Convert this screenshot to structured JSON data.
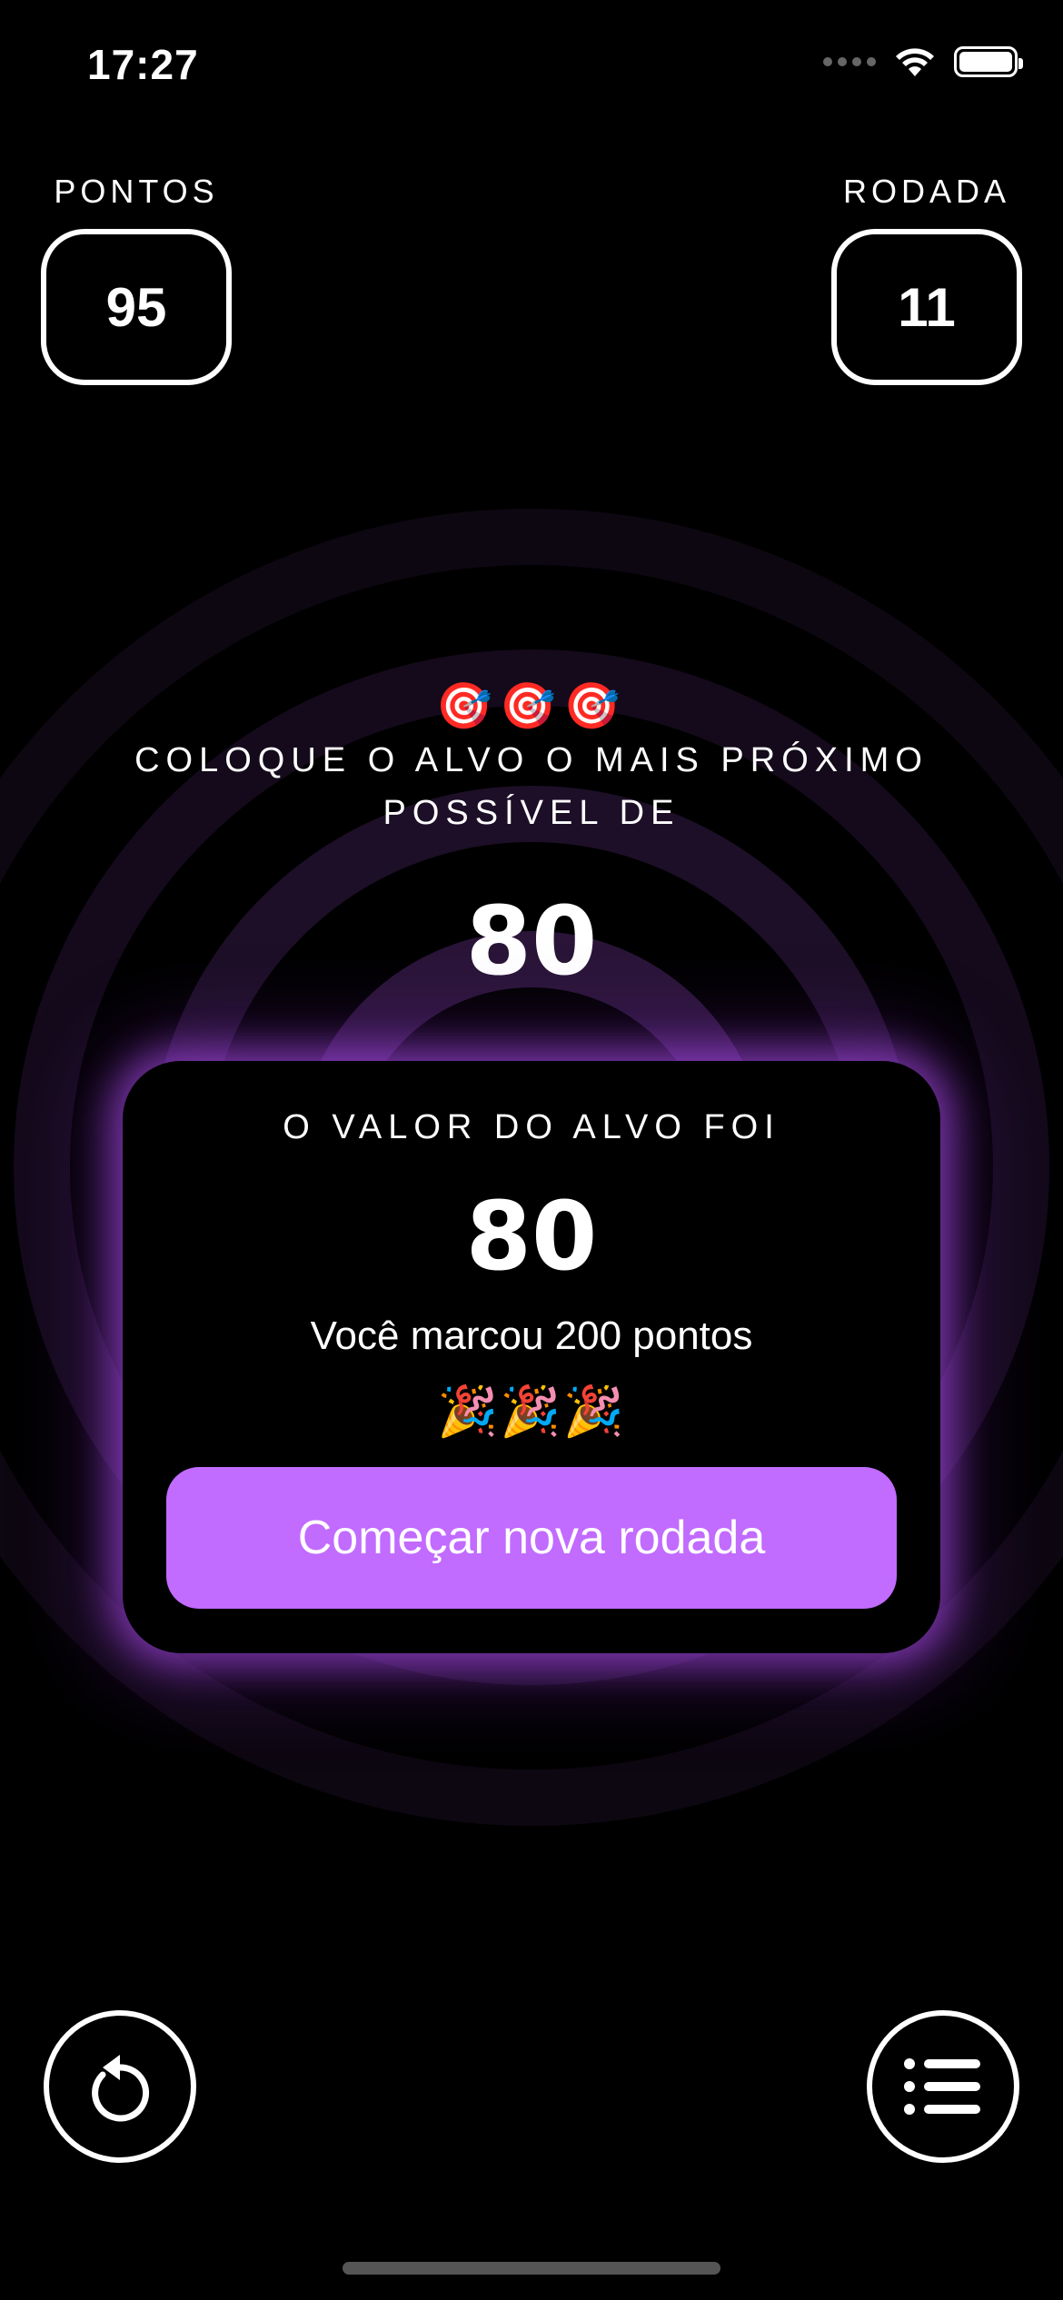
{
  "status_bar": {
    "time": "17:27"
  },
  "score": {
    "label": "PONTOS",
    "value": "95"
  },
  "round": {
    "label": "RODADA",
    "value": "11"
  },
  "target": {
    "emoji": "🎯🎯🎯",
    "instruction": "COLOQUE O ALVO O MAIS PRÓXIMO POSSÍVEL DE",
    "value": "80"
  },
  "result_card": {
    "title": "O VALOR DO ALVO FOI",
    "value": "80",
    "message": "Você marcou 200 pontos",
    "emoji": "🎉🎉🎉",
    "button_label": "Começar nova rodada"
  },
  "controls": {
    "restart_icon": "restart-icon",
    "leaderboard_icon": "list-icon"
  },
  "colors": {
    "accent": "#c26bff",
    "background": "#000000",
    "ring": "#1a0f22"
  }
}
